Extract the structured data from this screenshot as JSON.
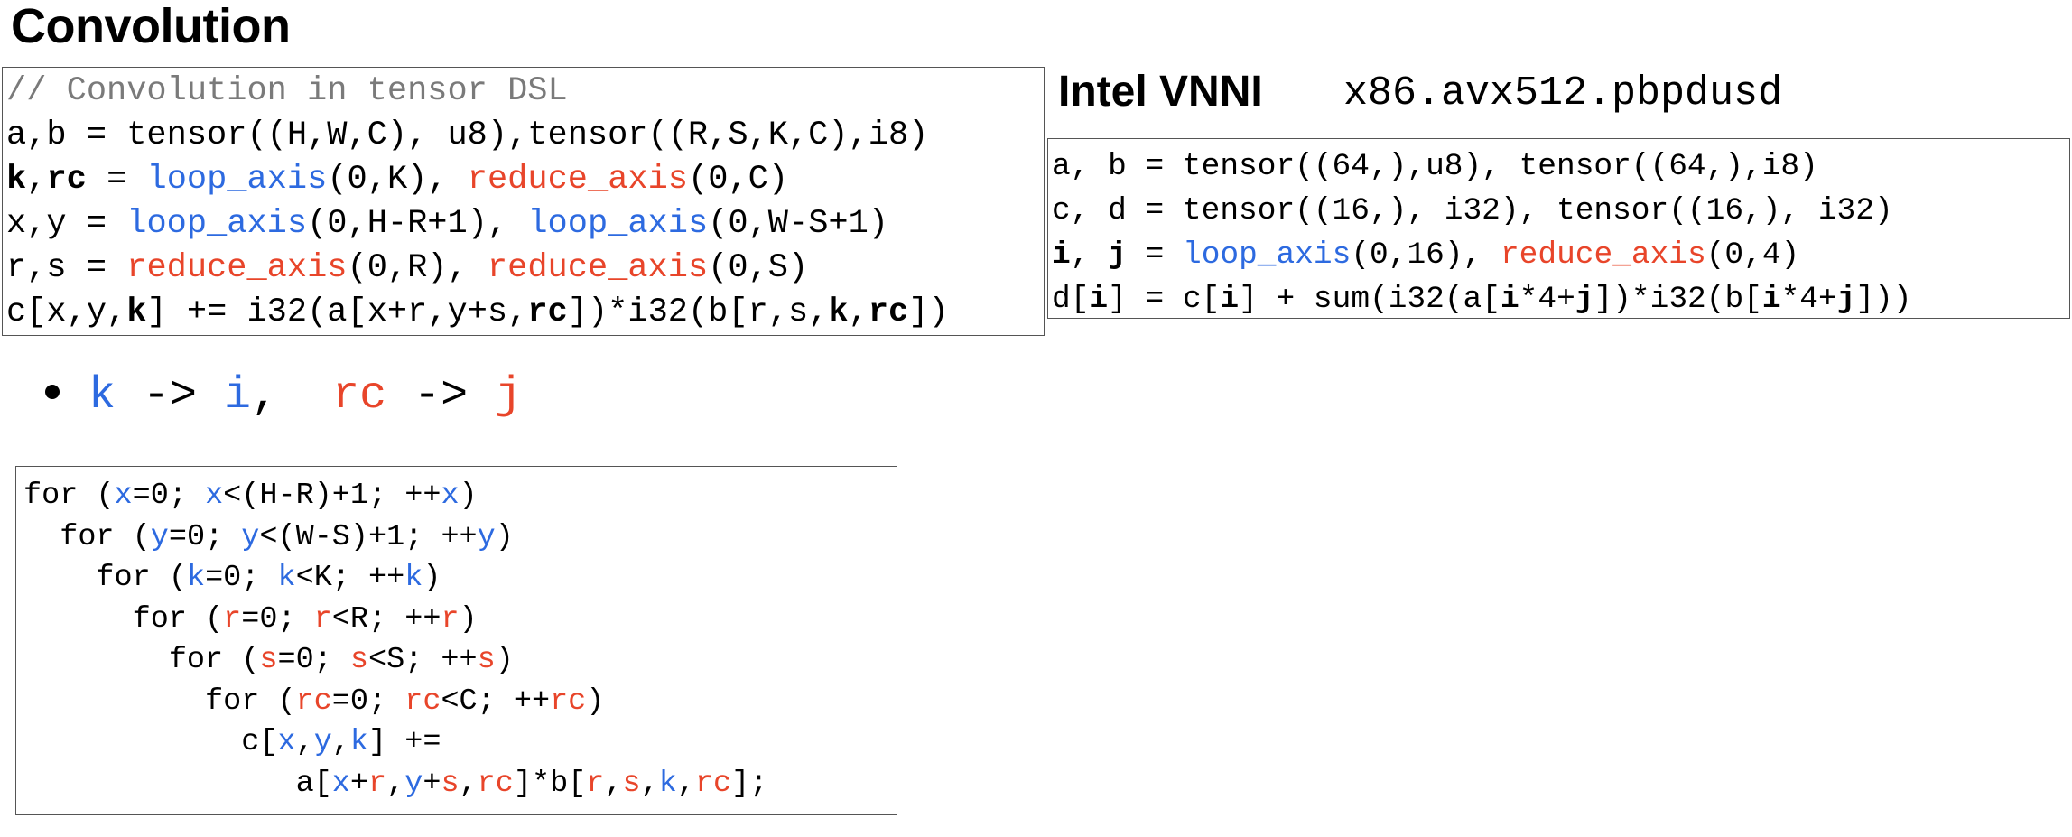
{
  "title": "Convolution",
  "dsl": {
    "comment": "// Convolution in tensor DSL",
    "line1": "a,b = tensor((H,W,C), u8),tensor((R,S,K,C),i8)",
    "line2": {
      "k": "k",
      "sep": ",",
      "rc": "rc",
      "eq": " = ",
      "loop": "loop_axis",
      "loop_args": "(0,K), ",
      "reduce": "reduce_axis",
      "reduce_args": "(0,C)"
    },
    "line3": {
      "prefix": "x,y = ",
      "loop1": "loop_axis",
      "args1": "(0,H-R+1), ",
      "loop2": "loop_axis",
      "args2": "(0,W-S+1)"
    },
    "line4": {
      "prefix": "r,s = ",
      "reduce1": "reduce_axis",
      "args1": "(0,R), ",
      "reduce2": "reduce_axis",
      "args2": "(0,S)"
    },
    "line5": {
      "p1": "c[x,y,",
      "k1": "k",
      "p2": "] += i32(a[x+r,y+s,",
      "rc1": "rc",
      "p3": "])*i32(b[r,s,",
      "k2": "k",
      "p4": ",",
      "rc2": "rc",
      "p5": "])"
    }
  },
  "vnni": {
    "title": "Intel VNNI",
    "instruction": "x86.avx512.pbpdusd",
    "line1": "a, b = tensor((64,),u8), tensor((64,),i8)",
    "line2": "c, d = tensor((16,), i32), tensor((16,), i32)",
    "line3": {
      "i": "i",
      "sep": ", ",
      "j": "j",
      "eq": " = ",
      "loop": "loop_axis",
      "loop_args": "(0,16), ",
      "reduce": "reduce_axis",
      "reduce_args": "(0,4)"
    },
    "line4": {
      "p1": "d[",
      "i1": "i",
      "p2": "] = c[",
      "i2": "i",
      "p3": "] + sum(i32(a[",
      "i3": "i",
      "p4": "*4+",
      "j1": "j",
      "p5": "])*i32(b[",
      "i4": "i",
      "p6": "*4+",
      "j2": "j",
      "p7": "]))"
    }
  },
  "mapping": {
    "k": "k",
    "arrow1": " -> ",
    "i": "i",
    "comma": ",  ",
    "rc": "rc",
    "arrow2": " -> ",
    "j": "j"
  },
  "loops": {
    "for": "for",
    "lines": [
      {
        "indent": "",
        "var": "x",
        "bound": "(H-R)+1"
      },
      {
        "indent": "  ",
        "var": "y",
        "bound": "(W-S)+1"
      },
      {
        "indent": "    ",
        "var": "k",
        "bound": "K"
      },
      {
        "indent": "      ",
        "var": "r",
        "bound": "R"
      },
      {
        "indent": "        ",
        "var": "s",
        "bound": "S"
      },
      {
        "indent": "          ",
        "var": "rc",
        "bound": "C"
      }
    ],
    "body1": {
      "indent": "            ",
      "p1": "c[",
      "x": "x",
      "c1": ",",
      "y": "y",
      "c2": ",",
      "k": "k",
      "p2": "] +="
    },
    "body2": {
      "indent": "               ",
      "p1": "a[",
      "x": "x",
      "plus1": "+",
      "r": "r",
      "c1": ",",
      "y": "y",
      "plus2": "+",
      "s": "s",
      "c2": ",",
      "rc": "rc",
      "p2": "]*b[",
      "r2": "r",
      "c3": ",",
      "s2": "s",
      "c4": ",",
      "k": "k",
      "c5": ",",
      "rc2": "rc",
      "p3": "];"
    }
  },
  "colors": {
    "loop_axis": "#2d6ae0",
    "reduce_axis": "#e8452a",
    "comment": "#7a7a7a"
  }
}
